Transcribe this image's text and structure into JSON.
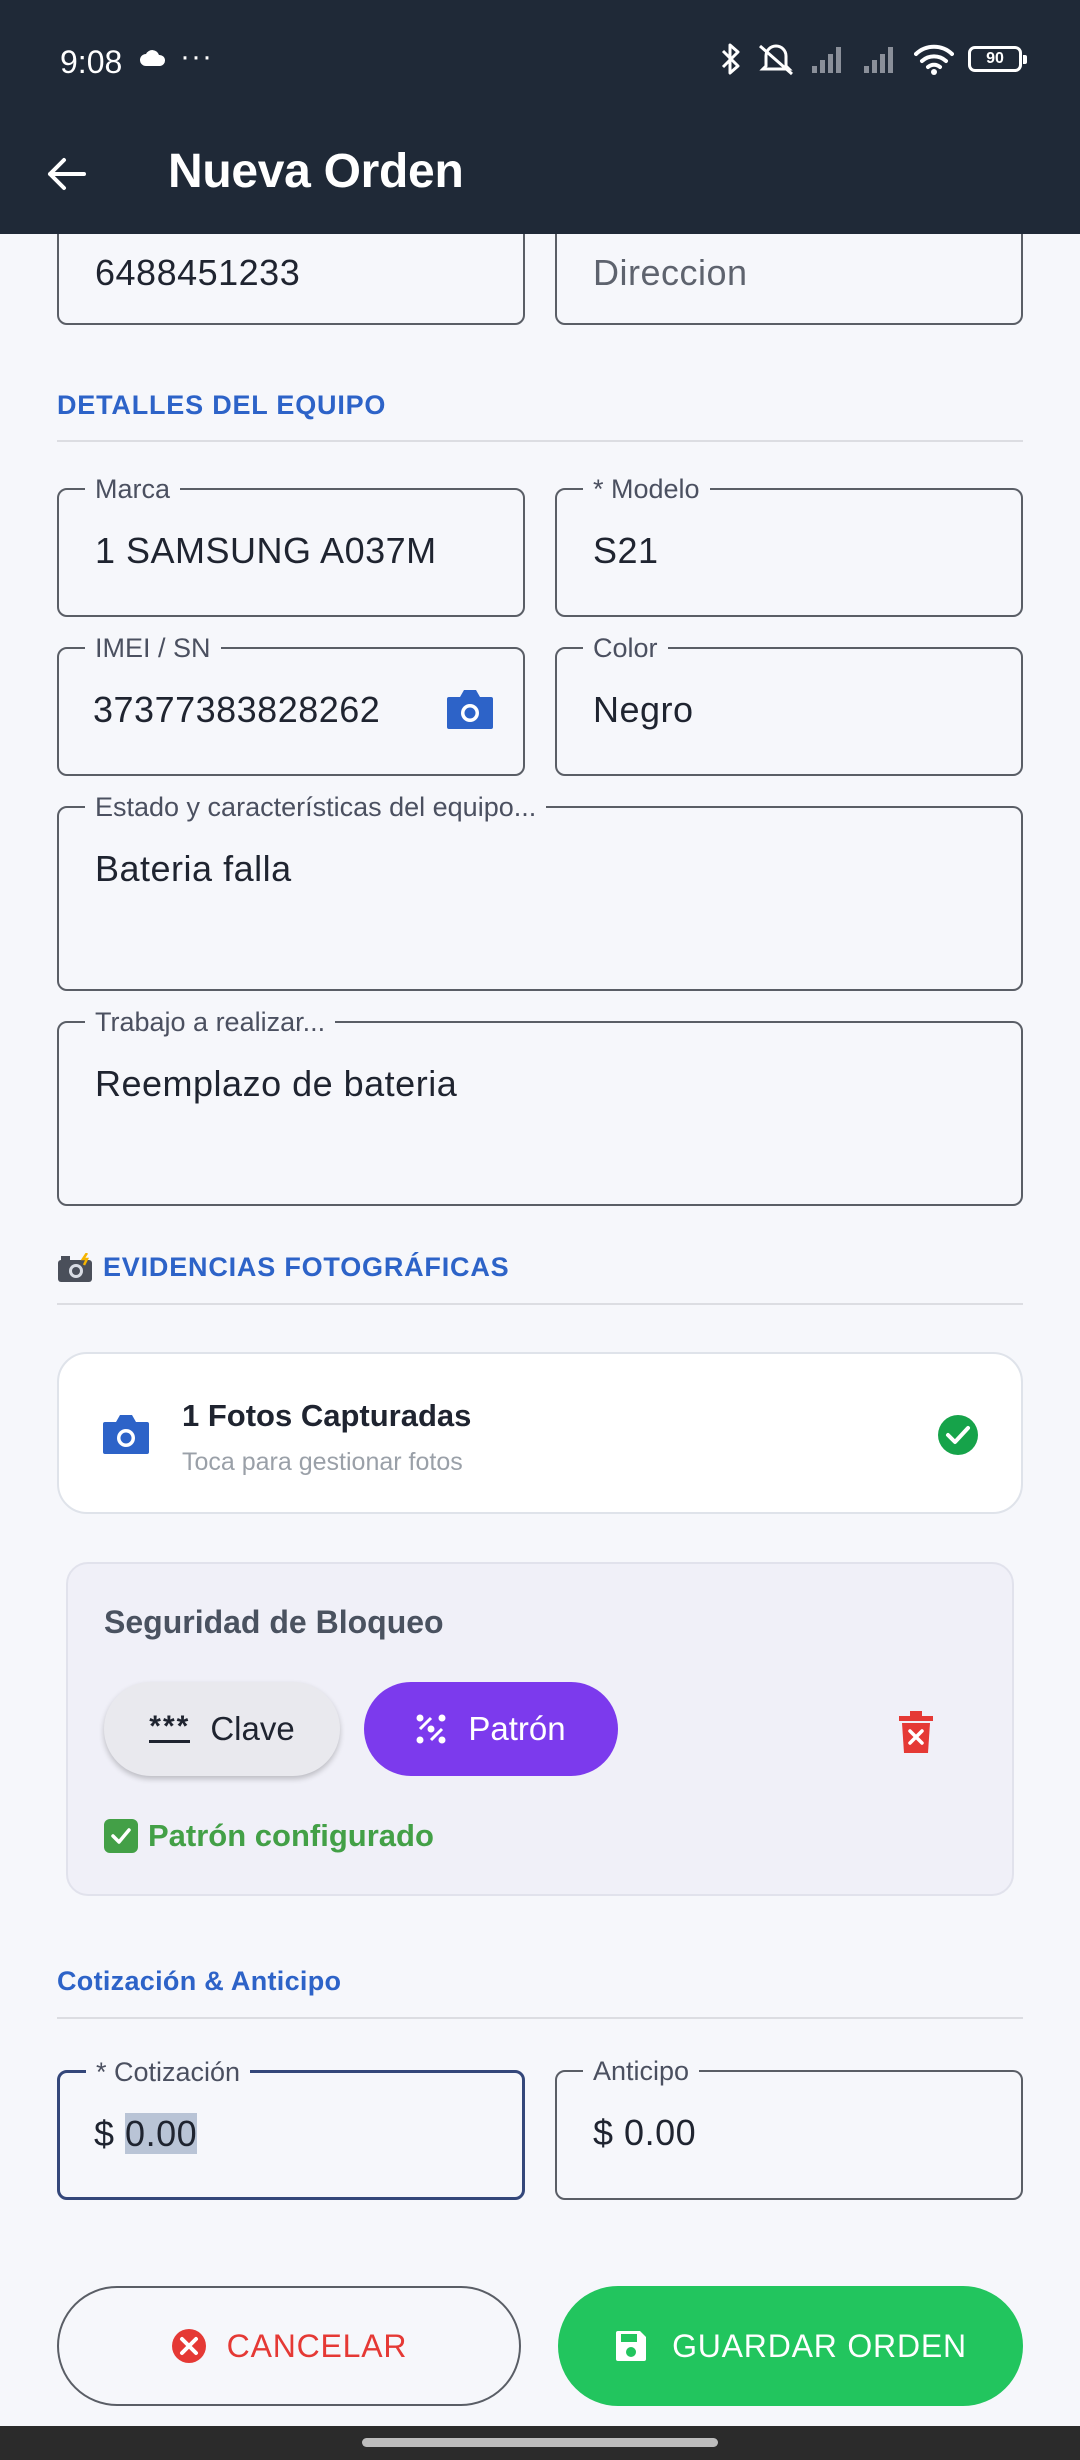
{
  "status_bar": {
    "time": "9:08",
    "dots": "···",
    "battery": "90"
  },
  "app_bar": {
    "title": "Nueva Orden"
  },
  "contact": {
    "phone_value": "6488451233",
    "address_placeholder": "Direccion"
  },
  "equipment": {
    "section_title": "DETALLES DEL EQUIPO",
    "brand": {
      "label": "Marca",
      "value": "1  SAMSUNG A037M"
    },
    "model": {
      "label": "* Modelo",
      "value": "S21"
    },
    "imei": {
      "label": "IMEI / SN",
      "value": "37377383828262"
    },
    "color": {
      "label": "Color",
      "value": "Negro"
    },
    "condition": {
      "label": "Estado y características del equipo...",
      "value": "Bateria falla"
    },
    "work": {
      "label": "Trabajo a realizar...",
      "value": "Reemplazo de bateria"
    }
  },
  "photos": {
    "section_title": "EVIDENCIAS FOTOGRÁFICAS",
    "title": "1 Fotos Capturadas",
    "subtitle": "Toca para gestionar fotos"
  },
  "security": {
    "title": "Seguridad de Bloqueo",
    "clave_icon_text": "***",
    "clave_label": "Clave",
    "patron_label": "Patrón",
    "status": "Patrón configurado"
  },
  "quote": {
    "section_title": "Cotización & Anticipo",
    "cotizacion": {
      "label": "* Cotización",
      "prefix": "$",
      "value": "0.00"
    },
    "anticipo": {
      "label": "Anticipo",
      "prefix": "$",
      "value": "0.00"
    }
  },
  "actions": {
    "cancel_label": "CANCELAR",
    "save_label": "GUARDAR ORDEN"
  },
  "colors": {
    "app_bar": "#1f2937",
    "section_blue": "#2d63c8",
    "patron_purple": "#7c3aed",
    "save_green": "#22c55e",
    "cancel_red": "#e53935",
    "success_green": "#43a047"
  }
}
